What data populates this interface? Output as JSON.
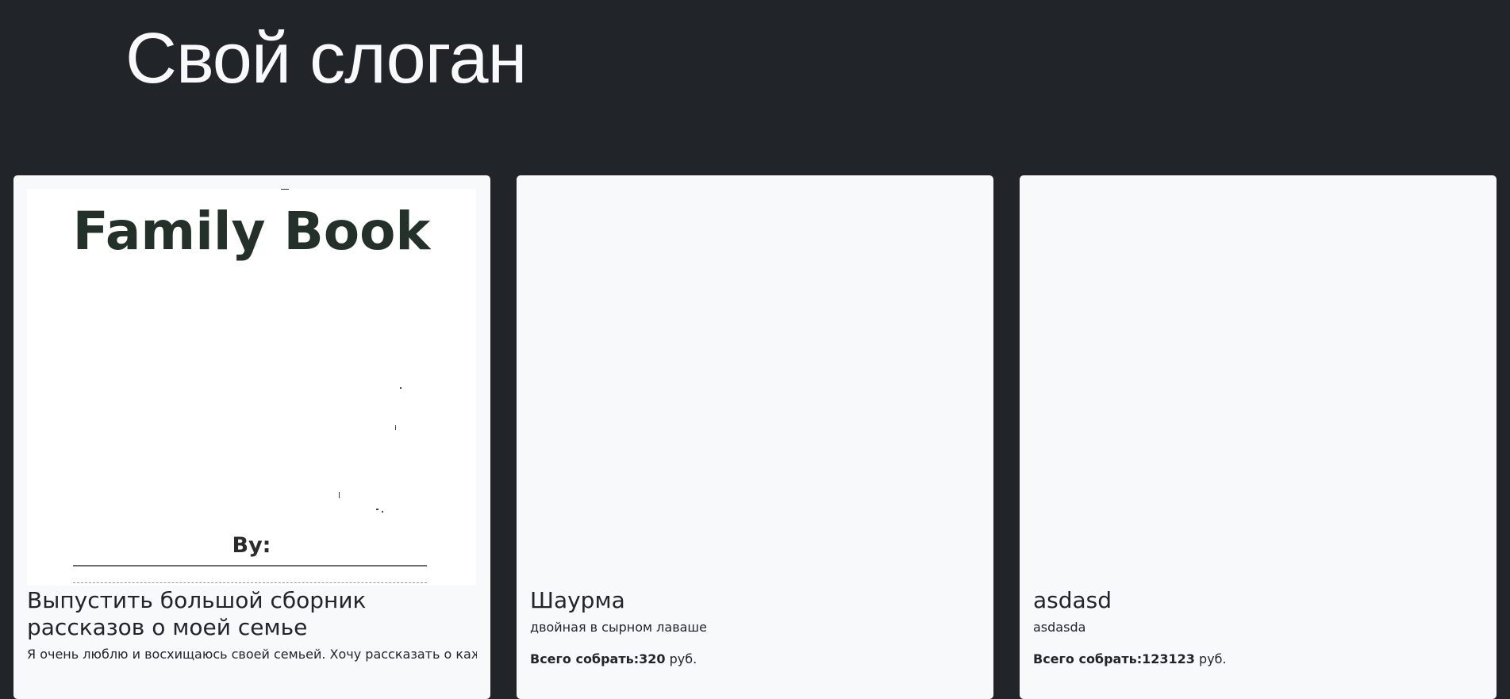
{
  "header": {
    "slogan": "Свой слоган"
  },
  "cards": [
    {
      "image": {
        "title": "Family Book",
        "by": "By:"
      },
      "title": "Выпустить большой сборник рассказов о моей семье",
      "description": "Я очень люблю и восхищаюсь своей семьей. Хочу рассказать о каждом"
    },
    {
      "title": "Шаурма",
      "description": "двойная в сырном лаваше",
      "goal_label": "Всего собрать:",
      "goal_value": "320",
      "goal_unit": "руб."
    },
    {
      "title": "asdasd",
      "description": "asdasda",
      "goal_label": "Всего собрать:",
      "goal_value": "123123",
      "goal_unit": "руб."
    }
  ]
}
